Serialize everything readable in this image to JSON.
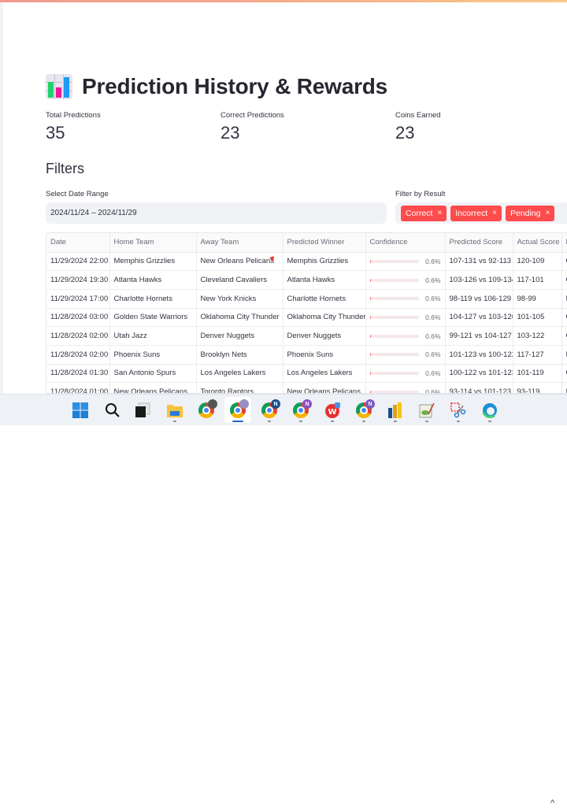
{
  "page": {
    "title": "Prediction History & Rewards",
    "title_icon": "bar-chart-icon"
  },
  "metrics": [
    {
      "label": "Total Predictions",
      "value": "35"
    },
    {
      "label": "Correct Predictions",
      "value": "23"
    },
    {
      "label": "Coins Earned",
      "value": "23"
    }
  ],
  "filters": {
    "heading": "Filters",
    "date_range": {
      "label": "Select Date Range",
      "value": "2024/11/24 – 2024/11/29"
    },
    "result": {
      "label": "Filter by Result",
      "selected": [
        "Correct",
        "Incorrect",
        "Pending"
      ],
      "remove_icon": "×"
    }
  },
  "table": {
    "columns": [
      "Date",
      "Home Team",
      "Away Team",
      "Predicted Winner",
      "Confidence",
      "Predicted Score",
      "Actual Score",
      "Result"
    ],
    "rows": [
      {
        "date": "11/29/2024 22:00",
        "home": "Memphis Grizzlies",
        "away": "New Orleans Pelicans",
        "winner": "Memphis Grizzlies",
        "confidence": 0.6,
        "confidence_label": "0.6%",
        "predicted_score": "107-131 vs 92-113",
        "actual_score": "120-109",
        "result": "Correct"
      },
      {
        "date": "11/29/2024 19:30",
        "home": "Atlanta Hawks",
        "away": "Cleveland Cavaliers",
        "winner": "Atlanta Hawks",
        "confidence": 0.6,
        "confidence_label": "0.6%",
        "predicted_score": "103-126 vs 109-134",
        "actual_score": "117-101",
        "result": "Correct"
      },
      {
        "date": "11/29/2024 17:00",
        "home": "Charlotte Hornets",
        "away": "New York Knicks",
        "winner": "Charlotte Hornets",
        "confidence": 0.6,
        "confidence_label": "0.6%",
        "predicted_score": "98-119 vs 106-129",
        "actual_score": "98-99",
        "result": "Incorrect"
      },
      {
        "date": "11/28/2024 03:00",
        "home": "Golden State Warriors",
        "away": "Oklahoma City Thunder",
        "winner": "Oklahoma City Thunder",
        "confidence": 0.6,
        "confidence_label": "0.6%",
        "predicted_score": "104-127 vs 103-126",
        "actual_score": "101-105",
        "result": "Correct"
      },
      {
        "date": "11/28/2024 02:00",
        "home": "Utah Jazz",
        "away": "Denver Nuggets",
        "winner": "Denver Nuggets",
        "confidence": 0.6,
        "confidence_label": "0.6%",
        "predicted_score": "99-121 vs 104-127",
        "actual_score": "103-122",
        "result": "Correct"
      },
      {
        "date": "11/28/2024 02:00",
        "home": "Phoenix Suns",
        "away": "Brooklyn Nets",
        "winner": "Phoenix Suns",
        "confidence": 0.6,
        "confidence_label": "0.6%",
        "predicted_score": "101-123 vs 100-122",
        "actual_score": "117-127",
        "result": "Incorrect"
      },
      {
        "date": "11/28/2024 01:30",
        "home": "San Antonio Spurs",
        "away": "Los Angeles Lakers",
        "winner": "Los Angeles Lakers",
        "confidence": 0.6,
        "confidence_label": "0.6%",
        "predicted_score": "100-122 vs 101-123",
        "actual_score": "101-119",
        "result": "Correct"
      },
      {
        "date": "11/28/2024 01:00",
        "home": "New Orleans Pelicans",
        "away": "Toronto Raptors",
        "winner": "New Orleans Pelicans",
        "confidence": 0.6,
        "confidence_label": "0.6%",
        "predicted_score": "93-114 vs 101-123",
        "actual_score": "93-119",
        "result": "Incorrect"
      }
    ]
  },
  "colors": {
    "accent": "#ff4b4b",
    "input_bg": "#f0f2f6",
    "text": "#31333f"
  },
  "taskbar": {
    "items": [
      {
        "name": "start-icon"
      },
      {
        "name": "search-icon"
      },
      {
        "name": "task-view-icon"
      },
      {
        "name": "file-explorer-icon"
      },
      {
        "name": "chrome-profile-1-icon"
      },
      {
        "name": "chrome-profile-2-icon",
        "active": true
      },
      {
        "name": "chrome-profile-n-blue-icon",
        "badge": "N"
      },
      {
        "name": "chrome-profile-n-purple-icon",
        "badge": "N"
      },
      {
        "name": "wps-office-icon"
      },
      {
        "name": "chrome-profile-n-purple-2-icon",
        "badge": "N"
      },
      {
        "name": "power-bi-icon"
      },
      {
        "name": "notepad-plus-plus-icon"
      },
      {
        "name": "snipping-tool-icon"
      },
      {
        "name": "edge-icon"
      }
    ],
    "overflow_icon": "^"
  }
}
